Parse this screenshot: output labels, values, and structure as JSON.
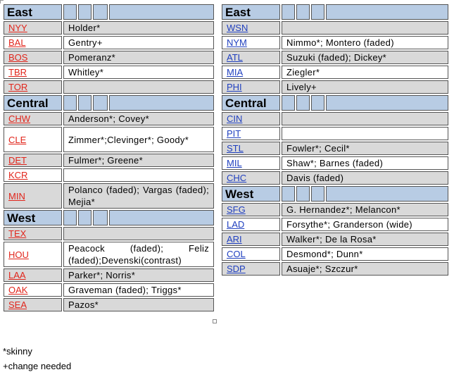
{
  "al": {
    "east": {
      "division": "East",
      "teams": [
        {
          "code": "NYY",
          "players": "Holder*",
          "shade": "grey"
        },
        {
          "code": "BAL",
          "players": "Gentry+",
          "shade": "white"
        },
        {
          "code": "BOS",
          "players": "Pomeranz*",
          "shade": "grey"
        },
        {
          "code": "TBR",
          "players": "Whitley*",
          "shade": "white"
        },
        {
          "code": "TOR",
          "players": "",
          "shade": "grey"
        }
      ]
    },
    "central": {
      "division": "Central",
      "teams": [
        {
          "code": "CHW",
          "players": "Anderson*; Covey*",
          "shade": "grey"
        },
        {
          "code": "CLE",
          "players": "Zimmer*;Clevinger*; Goody*",
          "shade": "white",
          "tall": true
        },
        {
          "code": "DET",
          "players": "Fulmer*; Greene*",
          "shade": "grey"
        },
        {
          "code": "KCR",
          "players": "",
          "shade": "white"
        },
        {
          "code": "MIN",
          "players": "Polanco (faded); Vargas (faded); Mejia*",
          "shade": "grey",
          "tall": true,
          "justify": true
        }
      ]
    },
    "west": {
      "division": "West",
      "teams": [
        {
          "code": "TEX",
          "players": "",
          "shade": "grey"
        },
        {
          "code": "HOU",
          "players": "Peacock (faded); Feliz (faded);Devenski(contrast)",
          "shade": "white",
          "tall": true,
          "justify": true
        },
        {
          "code": "LAA",
          "players": "Parker*; Norris*",
          "shade": "grey"
        },
        {
          "code": "OAK",
          "players": "Graveman (faded); Triggs*",
          "shade": "white"
        },
        {
          "code": "SEA",
          "players": "Pazos*",
          "shade": "grey"
        }
      ]
    }
  },
  "nl": {
    "east": {
      "division": "East",
      "teams": [
        {
          "code": "WSN",
          "players": "",
          "shade": "grey"
        },
        {
          "code": "NYM",
          "players": "Nimmo*; Montero (faded)",
          "shade": "white"
        },
        {
          "code": "ATL",
          "players": "Suzuki (faded); Dickey*",
          "shade": "grey"
        },
        {
          "code": "MIA",
          "players": "Ziegler*",
          "shade": "white"
        },
        {
          "code": "PHI",
          "players": "Lively+",
          "shade": "grey"
        }
      ]
    },
    "central": {
      "division": "Central",
      "teams": [
        {
          "code": "CIN",
          "players": "",
          "shade": "grey"
        },
        {
          "code": "PIT",
          "players": "",
          "shade": "white"
        },
        {
          "code": "STL",
          "players": "Fowler*; Cecil*",
          "shade": "grey"
        },
        {
          "code": "MIL",
          "players": "Shaw*; Barnes (faded)",
          "shade": "white"
        },
        {
          "code": "CHC",
          "players": "Davis (faded)",
          "shade": "grey"
        }
      ]
    },
    "west": {
      "division": "West",
      "teams": [
        {
          "code": "SFG",
          "players": "G. Hernandez*; Melancon*",
          "shade": "grey"
        },
        {
          "code": "LAD",
          "players": "Forsythe*; Granderson (wide)",
          "shade": "white"
        },
        {
          "code": "ARI",
          "players": "Walker*; De la Rosa*",
          "shade": "grey"
        },
        {
          "code": "COL",
          "players": "Desmond*; Dunn*",
          "shade": "white"
        },
        {
          "code": "SDP",
          "players": "Asuaje*; Szczur*",
          "shade": "grey"
        }
      ]
    }
  },
  "notes": {
    "line1": "*skinny",
    "line2": "+change needed"
  },
  "colors": {
    "header_bg": "#b8cce4",
    "row_grey": "#d9d9d9",
    "al_link": "#e1251b",
    "nl_link": "#1f3fbf"
  }
}
